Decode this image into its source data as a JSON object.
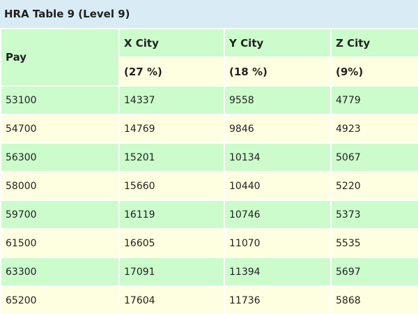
{
  "caption": "HRA Table 9 (Level 9)",
  "header": {
    "pay_label": "Pay",
    "columns": [
      {
        "city": "X City",
        "rate": "(27 %)"
      },
      {
        "city": "Y City",
        "rate": "(18 %)"
      },
      {
        "city": "Z City",
        "rate": "(9%)"
      }
    ]
  },
  "rows": [
    [
      "53100",
      "14337",
      "9558",
      "4779"
    ],
    [
      "54700",
      "14769",
      "9846",
      "4923"
    ],
    [
      "56300",
      "15201",
      "10134",
      "5067"
    ],
    [
      "58000",
      "15660",
      "10440",
      "5220"
    ],
    [
      "59700",
      "16119",
      "10746",
      "5373"
    ],
    [
      "61500",
      "16605",
      "11070",
      "5535"
    ],
    [
      "63300",
      "17091",
      "11394",
      "5697"
    ],
    [
      "65200",
      "17604",
      "11736",
      "5868"
    ]
  ],
  "colors": {
    "caption_bg": "#d9ecf6",
    "row_green": "#ccfbcc",
    "row_cream": "#feffe0"
  }
}
